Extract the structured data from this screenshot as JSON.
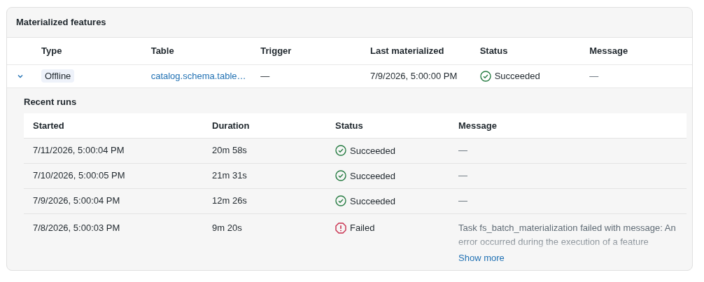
{
  "panel": {
    "title": "Materialized features"
  },
  "table": {
    "columns": [
      "Type",
      "Table",
      "Trigger",
      "Last materialized",
      "Status",
      "Message"
    ],
    "rows": [
      {
        "expanded": true,
        "type": "Offline",
        "table": "catalog.schema.table…",
        "trigger": "—",
        "last_materialized": "7/9/2026, 5:00:00 PM",
        "status": {
          "kind": "succeeded",
          "label": "Succeeded"
        },
        "message": "—"
      }
    ]
  },
  "recent_runs": {
    "title": "Recent runs",
    "columns": [
      "Started",
      "Duration",
      "Status",
      "Message"
    ],
    "rows": [
      {
        "started": "7/11/2026, 5:00:04 PM",
        "duration": "20m 58s",
        "status": {
          "kind": "succeeded",
          "label": "Succeeded"
        },
        "message": "—"
      },
      {
        "started": "7/10/2026, 5:00:05 PM",
        "duration": "21m 31s",
        "status": {
          "kind": "succeeded",
          "label": "Succeeded"
        },
        "message": "—"
      },
      {
        "started": "7/9/2026, 5:00:04 PM",
        "duration": "12m 26s",
        "status": {
          "kind": "succeeded",
          "label": "Succeeded"
        },
        "message": "—"
      },
      {
        "started": "7/8/2026, 5:00:03 PM",
        "duration": "9m 20s",
        "status": {
          "kind": "failed",
          "label": "Failed"
        },
        "message": "Task fs_batch_materialization failed with message: An error occurred during the execution of a feature",
        "show_more": "Show more"
      }
    ]
  }
}
